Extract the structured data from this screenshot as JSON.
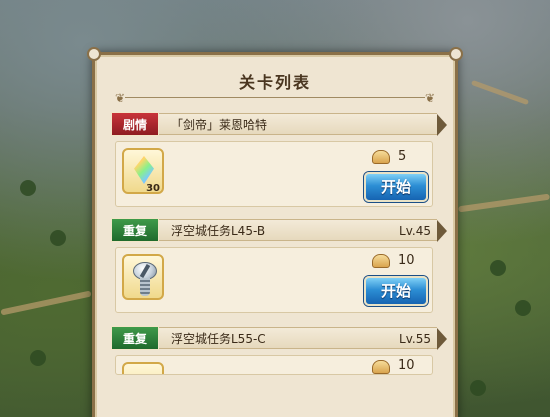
{
  "panel": {
    "title": "关卡列表"
  },
  "stages": [
    {
      "tag": "剧情",
      "tag_color": "#b0262c",
      "title": "「剑帝」莱恩哈特",
      "level": "",
      "item_icon": "rainbow-crystal-icon",
      "item_count": "30",
      "cost": "5",
      "button_label": "开始"
    },
    {
      "tag": "重复",
      "tag_color": "#2f7f3a",
      "title": "浮空城任务L45-B",
      "level": "Lv.45",
      "item_icon": "screw-icon",
      "item_count": "",
      "cost": "10",
      "button_label": "开始"
    },
    {
      "tag": "重复",
      "tag_color": "#2f7f3a",
      "title": "浮空城任务L55-C",
      "level": "Lv.55",
      "item_icon": "",
      "item_count": "",
      "cost": "10",
      "button_label": ""
    }
  ],
  "colors": {
    "panel_bg": "#efe5d2",
    "panel_border": "#8a7048",
    "button_blue": "#2c8ed4"
  }
}
